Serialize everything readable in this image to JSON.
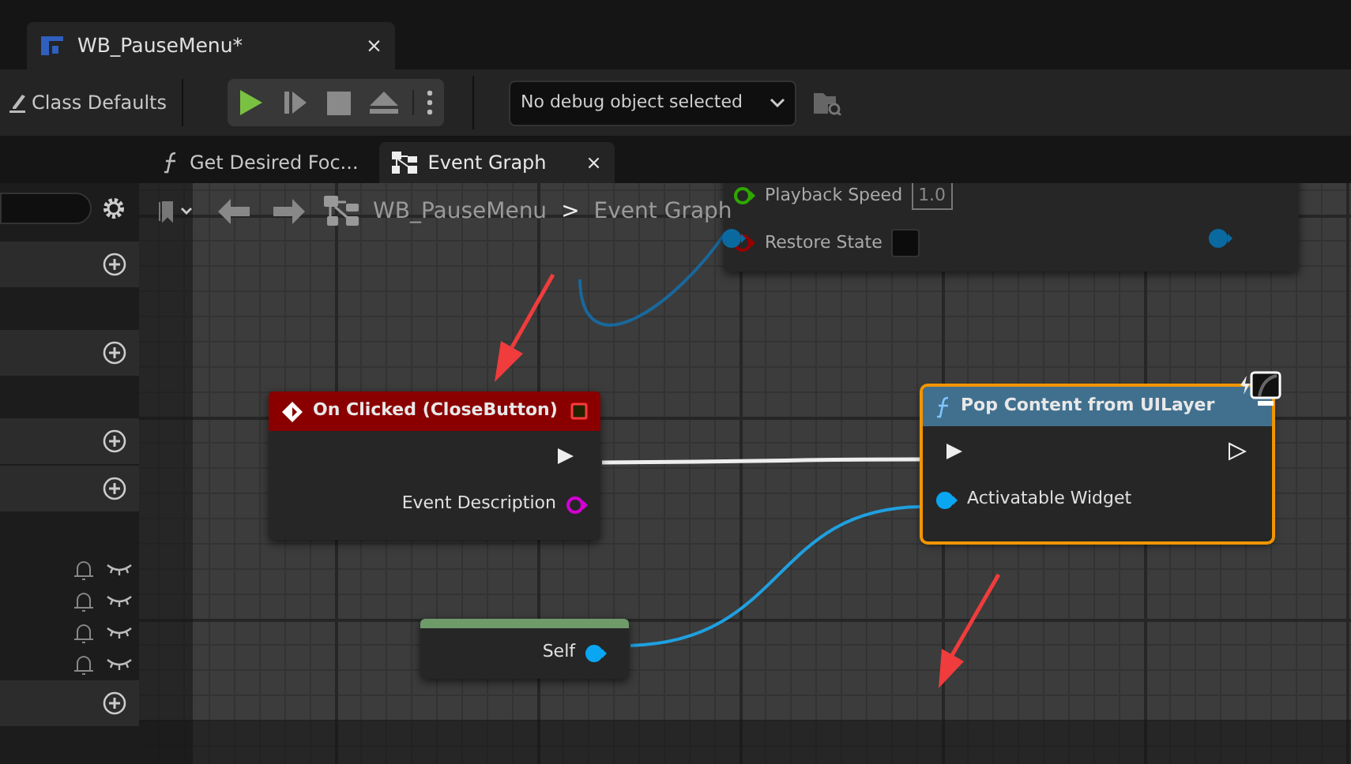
{
  "document_tab": {
    "title": "WB_PauseMenu*",
    "close": "×"
  },
  "toolbar": {
    "class_defaults": "Class Defaults",
    "debug_dropdown": {
      "value": "No debug object selected"
    }
  },
  "graph_tabs": [
    {
      "label": "Get Desired Foc...",
      "kind": "function",
      "selected": false
    },
    {
      "label": "Event Graph",
      "kind": "graph",
      "selected": true,
      "close": "×"
    }
  ],
  "breadcrumb": {
    "blueprint": "WB_PauseMenu",
    "separator": ">",
    "graph": "Event Graph"
  },
  "left_panel": {
    "rows": [
      {
        "kind": "category"
      },
      {
        "kind": "gap"
      },
      {
        "kind": "category"
      },
      {
        "kind": "gap"
      },
      {
        "kind": "category"
      },
      {
        "kind": "category"
      },
      {
        "kind": "gap"
      },
      {
        "kind": "variable"
      },
      {
        "kind": "variable"
      },
      {
        "kind": "variable"
      },
      {
        "kind": "variable"
      },
      {
        "kind": "category"
      }
    ]
  },
  "nodes": [
    {
      "kind": "plain",
      "selected": false,
      "inputs": [
        {
          "kind": "float",
          "label": "Playback Speed",
          "value": "1.0",
          "color": "#2ea800"
        },
        {
          "kind": "bool",
          "label": "Restore State",
          "checked": false,
          "color": "#950000"
        }
      ]
    },
    {
      "kind": "event",
      "title": "On Clicked (CloseButton)",
      "selected": false,
      "outputs": [
        {
          "kind": "exec"
        },
        {
          "kind": "delegate",
          "label": "Event Description",
          "color": "#d400d4"
        }
      ]
    },
    {
      "kind": "function",
      "title": "Pop Content from UILayer",
      "selected": true,
      "inputs": [
        {
          "kind": "exec"
        },
        {
          "kind": "object",
          "label": "Activatable Widget",
          "color": "#0aa6f2"
        }
      ],
      "outputs": [
        {
          "kind": "exec"
        }
      ]
    },
    {
      "kind": "self",
      "selected": false,
      "outputs": [
        {
          "kind": "object",
          "label": "Self",
          "color": "#0aa6f2"
        }
      ]
    }
  ]
}
